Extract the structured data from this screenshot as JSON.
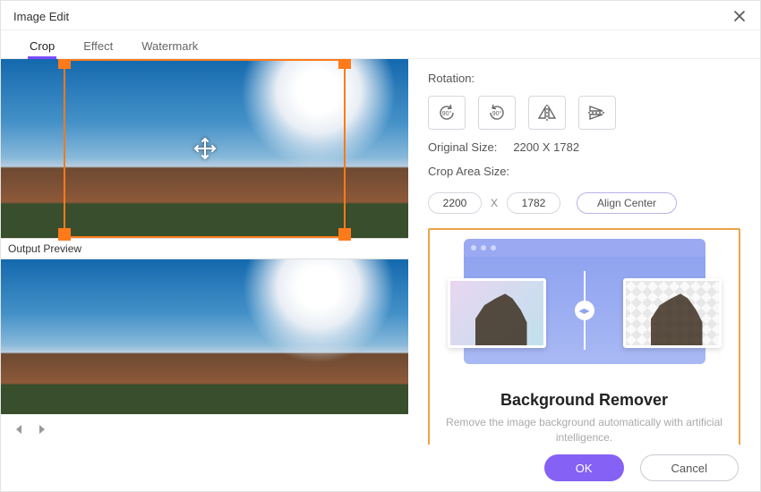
{
  "window": {
    "title": "Image Edit"
  },
  "tabs": {
    "crop": "Crop",
    "effect": "Effect",
    "watermark": "Watermark",
    "active": "crop"
  },
  "left": {
    "output_preview_label": "Output Preview"
  },
  "rotation": {
    "label": "Rotation:"
  },
  "original": {
    "label": "Original Size:",
    "value": "2200 X 1782"
  },
  "crop_area": {
    "label": "Crop Area Size:",
    "width": "2200",
    "height": "1782",
    "separator": "X",
    "align_center": "Align Center"
  },
  "promo": {
    "title": "Background Remover",
    "subtitle": "Remove the image background automatically with artificial intelligence."
  },
  "footer": {
    "ok": "OK",
    "cancel": "Cancel"
  }
}
